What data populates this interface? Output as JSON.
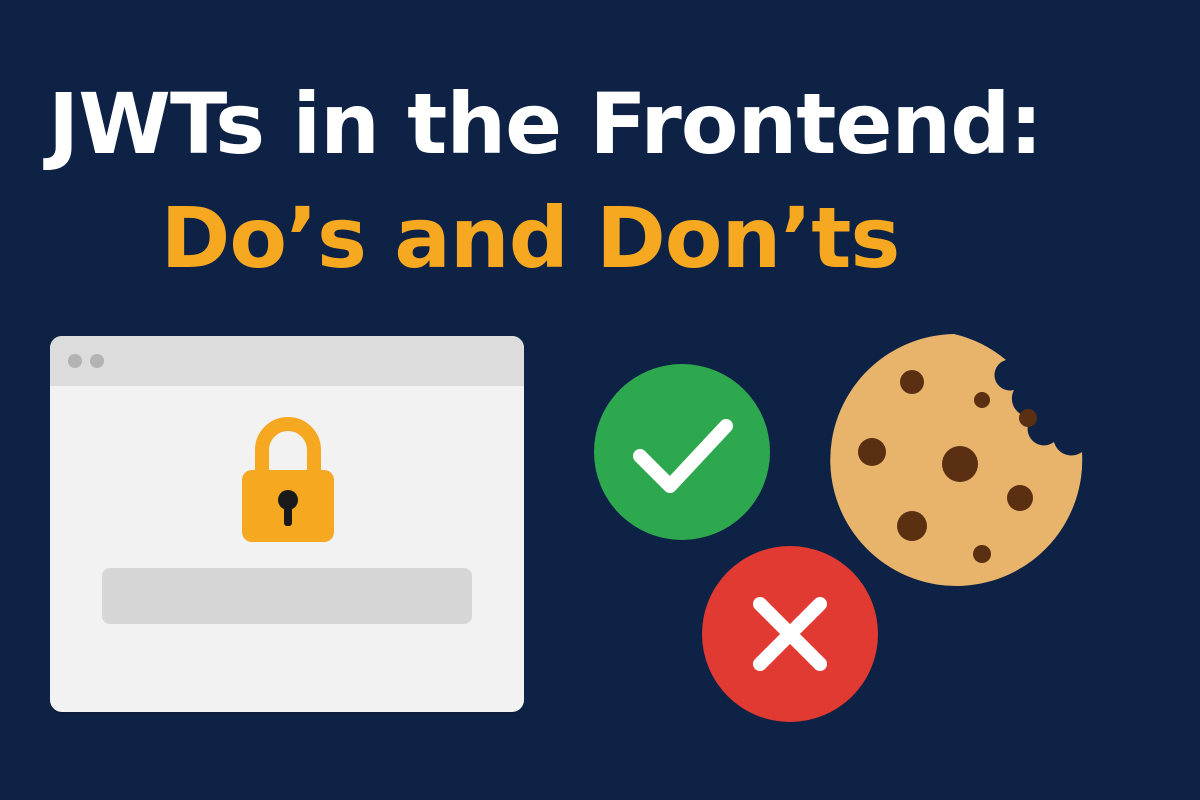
{
  "title": {
    "line1": "JWTs in the Frontend:",
    "line2": "Do’s and Don’ts"
  },
  "colors": {
    "background": "#0d2245",
    "title_primary": "#ffffff",
    "title_accent": "#f6a821",
    "lock": "#f6a821",
    "check_badge": "#2ea84f",
    "x_badge": "#e13a33",
    "cookie": "#e8b46c",
    "cookie_chips": "#5a2f12"
  },
  "icons": {
    "browser": "browser-window-icon",
    "lock": "padlock-icon",
    "check": "checkmark-icon",
    "cross": "x-mark-icon",
    "cookie": "cookie-icon"
  }
}
